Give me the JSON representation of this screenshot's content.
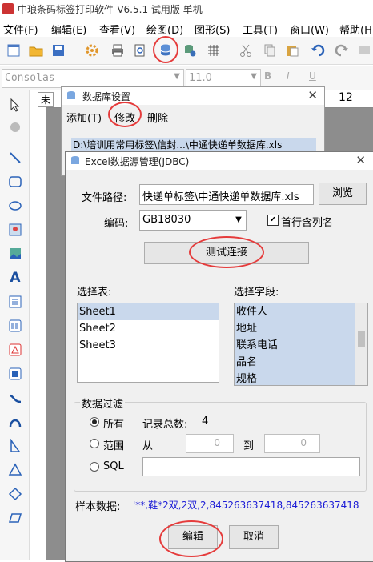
{
  "app": {
    "title": "中琅条码标签打印软件-V6.5.1 试用版 单机"
  },
  "menu": [
    "文件(F)",
    "编辑(E)",
    "查看(V)",
    "绘图(D)",
    "图形(S)",
    "工具(T)",
    "窗口(W)",
    "帮助(H)"
  ],
  "format_bar": {
    "font": "Consolas",
    "size": "11.0",
    "bold": "B",
    "italic": "I",
    "underline": "U"
  },
  "canvas": {
    "tab_label": "未",
    "ruler_number": "12"
  },
  "db_settings_dialog": {
    "title": "数据库设置",
    "menu_add": "添加(T)",
    "menu_edit": "修改",
    "menu_delete": "删除",
    "selected_row": "D:\\培训用常用标签\\信封...\\中通快递单数据库.xls"
  },
  "excel_dialog": {
    "title": "Excel数据源管理(JDBC)",
    "file_path_label": "文件路径:",
    "file_path_value": "快递单标签\\中通快递单数据库.xls",
    "browse_label": "浏览",
    "encoding_label": "编码:",
    "encoding_value": "GB18030",
    "first_row_label": "首行含列名",
    "test_button": "测试连接",
    "select_table_label": "选择表:",
    "tables": [
      "Sheet1",
      "Sheet2",
      "Sheet3"
    ],
    "select_field_label": "选择字段:",
    "fields": [
      "收件人",
      "地址",
      "联系电话",
      "品名",
      "规格"
    ],
    "filter_label": "数据过滤",
    "radio_all": "所有",
    "total_label": "记录总数:",
    "total_value": "4",
    "radio_range": "范围",
    "range_from": "从",
    "range_from_value": "0",
    "range_to": "到",
    "range_to_value": "0",
    "radio_sql": "SQL",
    "sample_label": "样本数据:",
    "sample_value": "'**,鞋*2双,2双,2,845263637418,845263637418",
    "edit_button": "编辑",
    "cancel_button": "取消"
  },
  "colors": {
    "annotation": "#e53b3b",
    "selection": "#c9d8ec",
    "sample_text": "#1a1ad6"
  }
}
